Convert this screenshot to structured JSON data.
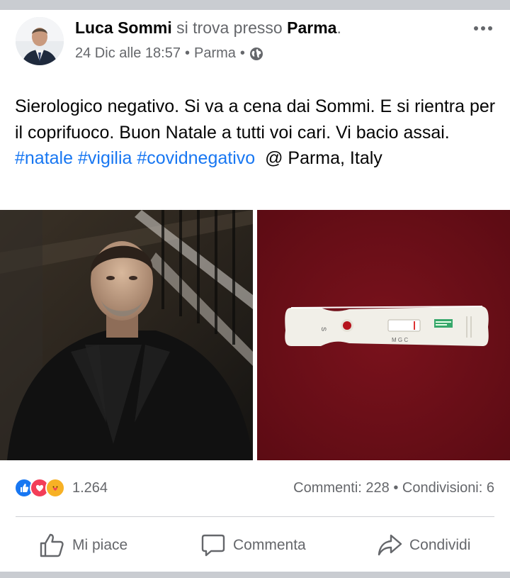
{
  "post": {
    "author": "Luca Sommi",
    "location_prefix": "si trova presso",
    "location": "Parma",
    "location_suffix": ".",
    "timestamp": "24 Dic alle 18:57",
    "place": "Parma",
    "sep": "•",
    "text_main": "Sierologico negativo. Si va a cena dai Sommi. E si rientra per il coprifuoco. Buon Natale a tutti voi cari. Vi bacio assai.",
    "hashtags": [
      "#natale",
      "#vigilia",
      "#covidnegativo"
    ],
    "text_tail": "@ Parma, Italy"
  },
  "reactions": {
    "count": "1.264",
    "types": [
      "like-icon",
      "love-icon",
      "care-icon"
    ]
  },
  "counts": {
    "comments": "Commenti: 228",
    "separator": "•",
    "shares": "Condivisioni: 6"
  },
  "actions": {
    "like": "Mi piace",
    "comment": "Commenta",
    "share": "Condividi"
  },
  "colors": {
    "link": "#1877f2",
    "muted": "#65676b",
    "text": "#050505",
    "like": "#1877f2",
    "love": "#f33e58",
    "care": "#f7b125"
  }
}
